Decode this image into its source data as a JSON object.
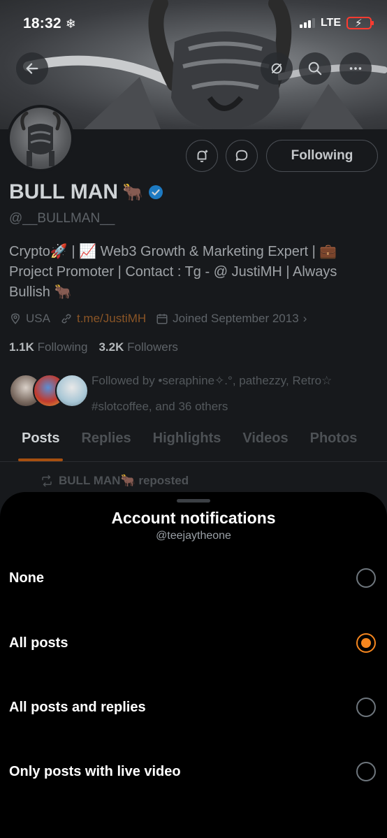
{
  "status_bar": {
    "time": "18:32",
    "time_icon": "snowflake-icon",
    "network": "LTE",
    "battery": "charging-low"
  },
  "profile": {
    "name": "BULL MAN",
    "name_emoji": "🐂",
    "verified": true,
    "handle": "@__BULLMAN__",
    "bio": "Crypto🚀 | 📈 Web3 Growth & Marketing Expert | 💼 Project Promoter | Contact : Tg - @ JustiMH | Always Bullish 🐂",
    "location": "USA",
    "link": "t.me/JustiMH",
    "joined": "Joined September 2013",
    "following_count": "1.1K",
    "following_label": "Following",
    "followers_count": "3.2K",
    "followers_label": "Followers",
    "followed_by": "Followed by •seraphine✧.°, pathezzy, Retro☆ #slotcoffee, and 36 others",
    "following_button": "Following",
    "tabs": [
      "Posts",
      "Replies",
      "Highlights",
      "Videos",
      "Photos"
    ],
    "active_tab": "Posts",
    "repost_label": "BULL MAN🐂 reposted"
  },
  "sheet": {
    "title": "Account notifications",
    "subtitle": "@teejaytheone",
    "options": [
      {
        "label": "None",
        "selected": false
      },
      {
        "label": "All posts",
        "selected": true
      },
      {
        "label": "All posts and replies",
        "selected": false
      },
      {
        "label": "Only posts with live video",
        "selected": false
      }
    ]
  },
  "colors": {
    "accent": "#f5861f",
    "sheet_bg": "#000000",
    "page_bg": "#17191c"
  }
}
